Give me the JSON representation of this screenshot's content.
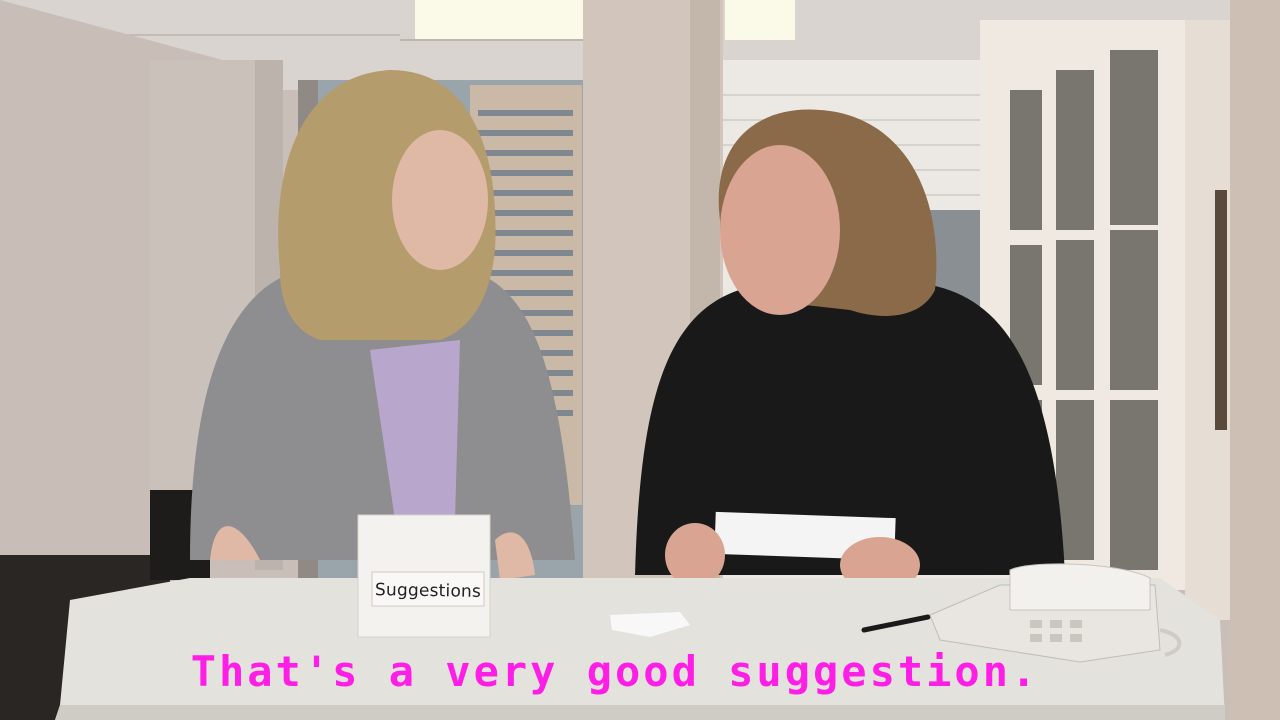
{
  "video": {
    "caption": "That's a very good suggestion.",
    "caption_color": "#ff1ee6"
  },
  "props": {
    "suggestion_box_label": "Suggestions"
  },
  "icons": [
    "phone-icon",
    "pen-icon"
  ]
}
